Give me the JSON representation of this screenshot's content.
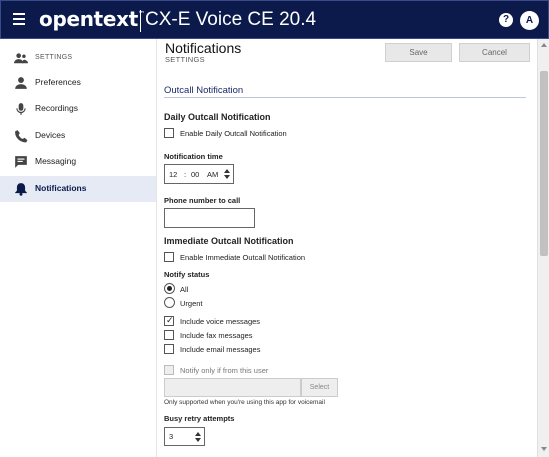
{
  "header": {
    "brand": "opentext",
    "brand_tm": "™",
    "product": "CX-E Voice CE 20.4",
    "help_label": "?",
    "avatar_initial": "A"
  },
  "sidebar": {
    "items": [
      {
        "label": "SETTINGS",
        "icon": "people-icon"
      },
      {
        "label": "Preferences",
        "icon": "person-icon"
      },
      {
        "label": "Recordings",
        "icon": "microphone-icon"
      },
      {
        "label": "Devices",
        "icon": "phone-icon"
      },
      {
        "label": "Messaging",
        "icon": "chat-icon"
      },
      {
        "label": "Notifications",
        "icon": "bell-icon",
        "active": true
      }
    ]
  },
  "page": {
    "title": "Notifications",
    "subtitle": "SETTINGS",
    "save_label": "Save",
    "cancel_label": "Cancel"
  },
  "outcall": {
    "section_title": "Outcall Notification",
    "daily_heading": "Daily Outcall Notification",
    "enable_daily_label": "Enable Daily Outcall Notification",
    "time_label": "Notification time",
    "time_hour": "12",
    "time_sep": ":",
    "time_minute": "00",
    "time_ampm": "AM",
    "phone_label": "Phone number to call",
    "phone_value": "",
    "immediate_heading": "Immediate Outcall Notification",
    "enable_immediate_label": "Enable Immediate Outcall Notification",
    "notify_status_label": "Notify status",
    "status_options": [
      "All",
      "Urgent"
    ],
    "status_selected": "All",
    "include_voice_label": "Include voice messages",
    "include_voice_checked": true,
    "include_fax_label": "Include fax messages",
    "include_email_label": "Include email messages",
    "notify_user_label": "Notify only if from this user",
    "select_label": "Select",
    "select_note": "Only supported when you're using this app for voicemail",
    "busy_retry_label": "Busy retry attempts",
    "busy_retry_value": "3"
  },
  "colors": {
    "topbar": "#0b1a4b",
    "active_bg": "#e6eaf4",
    "accent": "#1b2a6b"
  }
}
